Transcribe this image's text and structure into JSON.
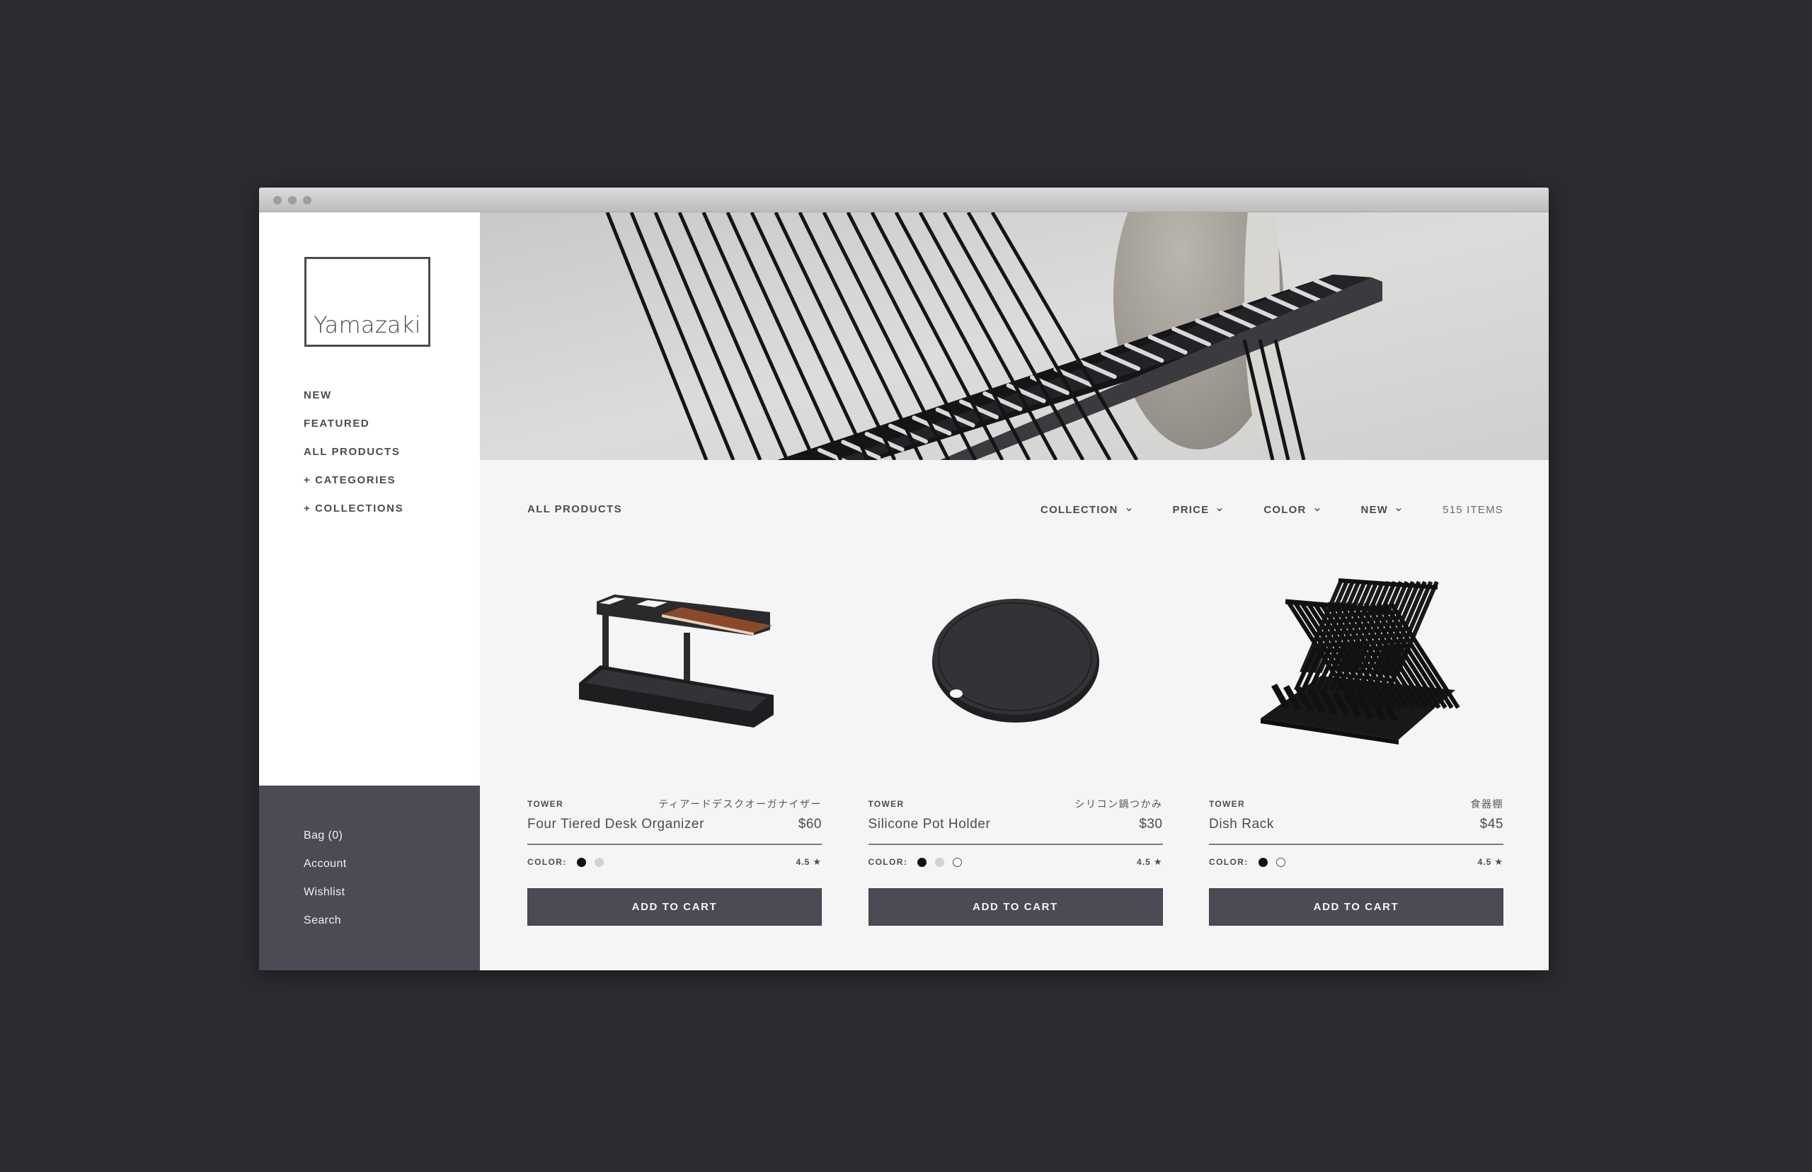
{
  "window": {
    "controls": [
      "close",
      "minimize",
      "maximize"
    ]
  },
  "brand": {
    "name": "Yamazaki"
  },
  "sidebar": {
    "nav": [
      {
        "label": "NEW"
      },
      {
        "label": "FEATURED"
      },
      {
        "label": "ALL PRODUCTS"
      },
      {
        "label": "+ CATEGORIES"
      },
      {
        "label": "+ COLLECTIONS"
      }
    ],
    "account_links": [
      {
        "label": "Bag (0)"
      },
      {
        "label": "Account"
      },
      {
        "label": "Wishlist"
      },
      {
        "label": "Search"
      }
    ]
  },
  "hero": {
    "subject": "dish rack close-up photo"
  },
  "toolbar": {
    "title": "ALL PRODUCTS",
    "filters": [
      {
        "label": "COLLECTION",
        "icon": "chevron-down-icon"
      },
      {
        "label": "PRICE",
        "icon": "chevron-down-icon"
      },
      {
        "label": "COLOR",
        "icon": "chevron-down-icon"
      },
      {
        "label": "NEW",
        "icon": "chevron-down-icon"
      }
    ],
    "item_count": "515 ITEMS"
  },
  "products": [
    {
      "collection": "TOWER",
      "jp_name": "ティアードデスクオーガナイザー",
      "name": "Four Tiered Desk Organizer",
      "price": "$60",
      "color_label": "COLOR:",
      "colors": [
        "#111111",
        "#d2d2d2"
      ],
      "rating": "4.5",
      "button": "ADD TO CART"
    },
    {
      "collection": "TOWER",
      "jp_name": "シリコン鍋つかみ",
      "name": "Silicone Pot Holder",
      "price": "$30",
      "color_label": "COLOR:",
      "colors": [
        "#111111",
        "#d2d2d2",
        "#ffffff"
      ],
      "rating": "4.5",
      "button": "ADD TO CART"
    },
    {
      "collection": "TOWER",
      "jp_name": "食器棚",
      "name": "Dish Rack",
      "price": "$45",
      "color_label": "COLOR:",
      "colors": [
        "#111111",
        "#ffffff"
      ],
      "rating": "4.5",
      "button": "ADD TO CART"
    }
  ],
  "colors": {
    "page_bg": "#2b2c31",
    "sidebar_dark": "#4b4b55",
    "accent_button": "#4b4b55",
    "text": "#4b4b52",
    "content_bg": "#f5f5f5"
  }
}
